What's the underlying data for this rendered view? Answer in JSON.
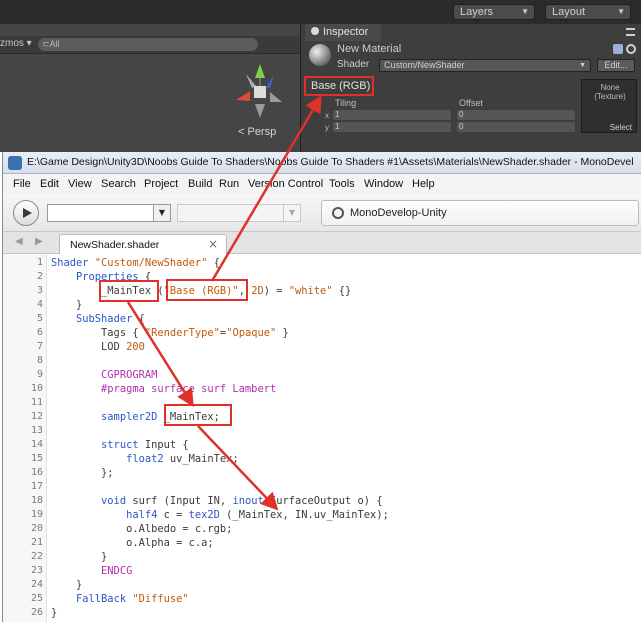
{
  "unity": {
    "layers_label": "Layers",
    "layout_label": "Layout",
    "scene": {
      "gizmos_label": "zmos ▾",
      "search_placeholder": "⊂All",
      "persp_label": "< Persp"
    },
    "inspector": {
      "tab_label": "Inspector",
      "material_name": "New Material",
      "shader_label": "Shader",
      "shader_value": "Custom/NewShader",
      "edit_label": "Edit...",
      "property_label": "Base (RGB)",
      "tiling_label": "Tiling",
      "offset_label": "Offset",
      "x_label": "x",
      "y_label": "y",
      "tiling_x": "1",
      "tiling_y": "1",
      "offset_x": "0",
      "offset_y": "0",
      "texture_none": "None\n(Texture)",
      "select_label": "Select"
    }
  },
  "monodevelop": {
    "title": "E:\\Game Design\\Unity3D\\Noobs Guide To Shaders\\Noobs Guide To Shaders #1\\Assets\\Materials\\NewShader.shader - MonoDevel",
    "menu": [
      "File",
      "Edit",
      "View",
      "Search",
      "Project",
      "Build",
      "Run",
      "Version Control",
      "Tools",
      "Window",
      "Help"
    ],
    "status_text": "MonoDevelop-Unity",
    "tab_label": "NewShader.shader",
    "line_numbers": [
      "1",
      "2",
      "3",
      "4",
      "5",
      "6",
      "7",
      "8",
      "9",
      "10",
      "11",
      "12",
      "13",
      "14",
      "15",
      "16",
      "17",
      "18",
      "19",
      "20",
      "21",
      "22",
      "23",
      "24",
      "25",
      "26"
    ]
  },
  "colors": {
    "keyword": "#2b56c8",
    "string": "#c05a0a",
    "preprocessor": "#b02fb0",
    "highlight": "#e0302a"
  }
}
